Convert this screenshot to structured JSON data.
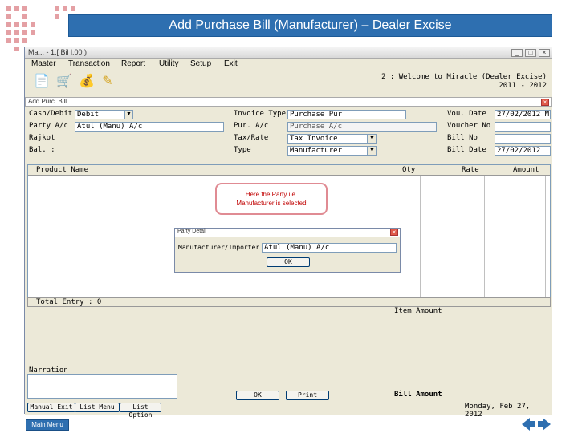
{
  "slide_title": "Add Purchase Bill (Manufacturer) – Dealer Excise",
  "window": {
    "title": "Ma... - 1.[ Bil l:00 )",
    "controls": [
      "_",
      "□",
      "×"
    ],
    "menu": [
      "Master",
      "Transaction",
      "Report",
      "Utility",
      "Setup",
      "Exit"
    ],
    "toolbar_icons": [
      "document-icon",
      "cart-icon",
      "money-bag-icon",
      "edit-icon"
    ],
    "welcome_line1": "2 : Welcome to Miracle (Dealer Excise)",
    "welcome_line2": "2011 - 2012",
    "status_date": "Monday, Feb 27, 2012"
  },
  "bill": {
    "title": "Add Purc. Bill",
    "labels": {
      "cash_debit": "Cash/Debit",
      "party_ac": "Party A/c",
      "rajkot": "Rajkot",
      "bal": "Bal. :",
      "invoice_type": "Invoice Type",
      "pur_ac": "Pur. A/c",
      "tax_rate": "Tax/Rate",
      "type": "Type",
      "vou_date": "Vou. Date",
      "voucher_no": "Voucher No",
      "bill_no": "Bill No",
      "bill_date": "Bill Date"
    },
    "values": {
      "cash_debit": "Debit",
      "party_ac": "Atul (Manu) A/c",
      "invoice_type": "Purchase Pur",
      "pur_ac": "Purchase A/c",
      "tax_rate": "Tax Invoice",
      "type": "Manufacturer",
      "vou_date": "27/02/2012 M",
      "voucher_no": "",
      "bill_no": "",
      "bill_date": "27/02/2012"
    },
    "grid_headers": [
      "Product Name",
      "Qty",
      "Rate",
      "Amount"
    ],
    "total_entry": "Total Entry : 0",
    "item_amount": "Item Amount",
    "narration": "Narration",
    "bill_amount": "Bill Amount",
    "buttons": {
      "manual_exit": "Manual Exit",
      "list_menu": "List Menu",
      "list_option": "List Option",
      "ok": "OK",
      "print": "Print"
    }
  },
  "party_dialog": {
    "title": "Party Detail",
    "label": "Manufacturer/Importer",
    "value": "Atul (Manu) A/c",
    "ok": "OK"
  },
  "callout": {
    "line1": "Here the Party i.e.",
    "line2": "Manufacturer is selected"
  },
  "main_menu": "Main Menu"
}
